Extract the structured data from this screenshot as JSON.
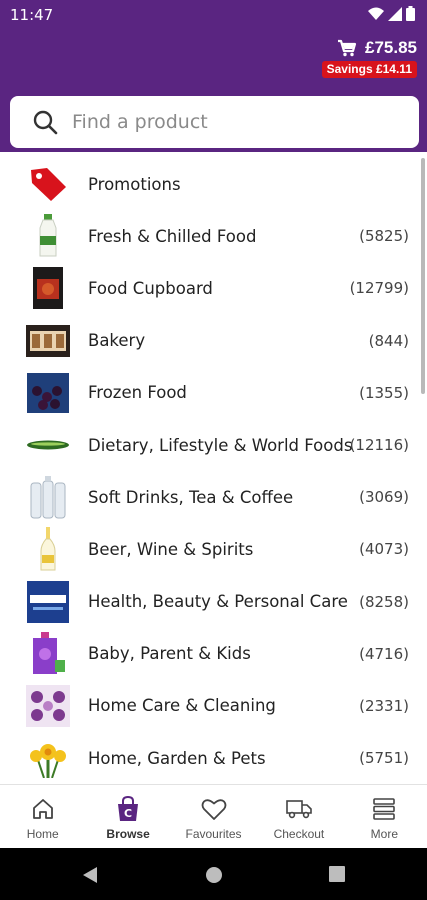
{
  "status_bar": {
    "time": "11:47"
  },
  "header": {
    "cart_total": "£75.85",
    "savings": "Savings £14.11",
    "brand_color": "#5a2581",
    "savings_color": "#d8131c"
  },
  "search": {
    "placeholder": "Find a product"
  },
  "categories": [
    {
      "label": "Promotions",
      "count": "",
      "icon": "tag-icon"
    },
    {
      "label": "Fresh & Chilled Food",
      "count": "(5825)",
      "icon": "milk-bottle-icon"
    },
    {
      "label": "Food Cupboard",
      "count": "(12799)",
      "icon": "jar-icon"
    },
    {
      "label": "Bakery",
      "count": "(844)",
      "icon": "cake-box-icon"
    },
    {
      "label": "Frozen Food",
      "count": "(1355)",
      "icon": "frozen-berries-icon"
    },
    {
      "label": "Dietary, Lifestyle & World Foods",
      "count": "(12116)",
      "icon": "cucumber-icon"
    },
    {
      "label": "Soft Drinks, Tea & Coffee",
      "count": "(3069)",
      "icon": "water-bottles-icon"
    },
    {
      "label": "Beer, Wine & Spirits",
      "count": "(4073)",
      "icon": "wine-bottle-icon"
    },
    {
      "label": "Health, Beauty & Personal Care",
      "count": "(8258)",
      "icon": "medicine-box-icon"
    },
    {
      "label": "Baby, Parent & Kids",
      "count": "(4716)",
      "icon": "baby-pouch-icon"
    },
    {
      "label": "Home Care & Cleaning",
      "count": "(2331)",
      "icon": "tissue-box-icon"
    },
    {
      "label": "Home, Garden & Pets",
      "count": "(5751)",
      "icon": "daffodils-icon"
    }
  ],
  "bottom_nav": [
    {
      "label": "Home",
      "icon": "home-icon"
    },
    {
      "label": "Browse",
      "icon": "bag-icon",
      "active": true
    },
    {
      "label": "Favourites",
      "icon": "heart-icon"
    },
    {
      "label": "Checkout",
      "icon": "truck-icon"
    },
    {
      "label": "More",
      "icon": "menu-icon"
    }
  ]
}
